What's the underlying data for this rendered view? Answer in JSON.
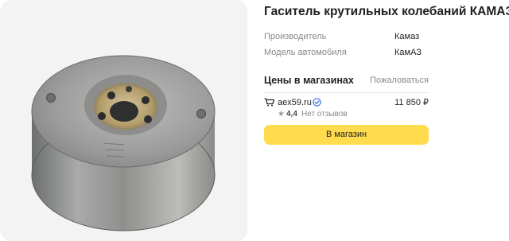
{
  "product": {
    "title": "Гаситель крутильных колебаний КАМАЗ",
    "image_alt": "torsional vibration damper"
  },
  "specs": [
    {
      "label": "Производитель",
      "value": "Камаз"
    },
    {
      "label": "Модель автомобиля",
      "value": "КамАЗ"
    }
  ],
  "prices": {
    "title": "Цены в магазинах",
    "complain_label": "Пожаловаться"
  },
  "offer": {
    "shop": "aex59.ru",
    "price": "11 850 ₽",
    "rating": "4,4",
    "reviews": "Нет отзывов",
    "icons": {
      "shop": "cart-icon",
      "verified": "verified-icon",
      "rating": "star-icon"
    },
    "verified_color": "#3b6fd8"
  },
  "button": {
    "label": "В магазин",
    "color": "#ffdb4d"
  }
}
